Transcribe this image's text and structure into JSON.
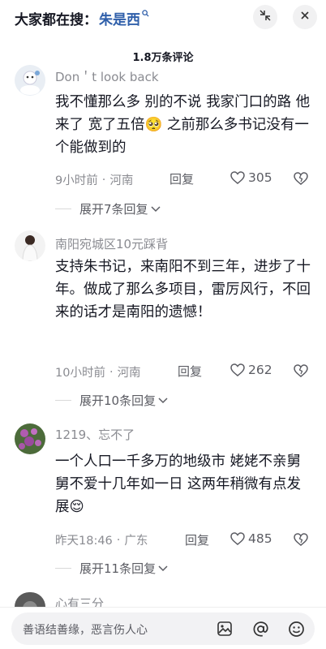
{
  "search": {
    "prefix": "大家都在搜：",
    "term": "朱是西",
    "term_icon": "search-icon",
    "collapse_icon": "collapse-icon",
    "close_icon": "close-icon"
  },
  "comments_header": {
    "count_label": "1.8万条评论"
  },
  "comments": [
    {
      "username": "Don＇t look back",
      "body": "我不懂那么多 别的不说 我家门口的路 他来了 宽了五倍🥺 之前那么多书记没有一个能做到的",
      "time": "9小时前",
      "location": "河南",
      "reply_label": "回复",
      "likes": "305",
      "expand_label": "展开7条回复"
    },
    {
      "username": "南阳宛城区10元踩背",
      "body": "支持朱书记，来南阳不到三年，进步了十年。做成了那么多项目，雷厉风行，不回来的话才是南阳的遗憾！",
      "time": "10小时前",
      "location": "河南",
      "reply_label": "回复",
      "likes": "262",
      "expand_label": "展开10条回复"
    },
    {
      "username": "1219、忘不了",
      "body": "一个人口一千多万的地级市 姥姥不亲舅舅不爱十几年如一日 这两年稍微有点发展😌",
      "time": "昨天18:46",
      "location": "广东",
      "reply_label": "回复",
      "likes": "485",
      "expand_label": "展开11条回复"
    },
    {
      "username": "心有三分"
    }
  ],
  "input_bar": {
    "placeholder": "善语结善缘，恶言伤人心",
    "image_icon": "image-icon",
    "mention_icon": "at-icon",
    "emoji_icon": "emoji-icon"
  },
  "colors": {
    "accent": "#2f5faa",
    "muted": "#8a8b91",
    "text": "#161823"
  }
}
